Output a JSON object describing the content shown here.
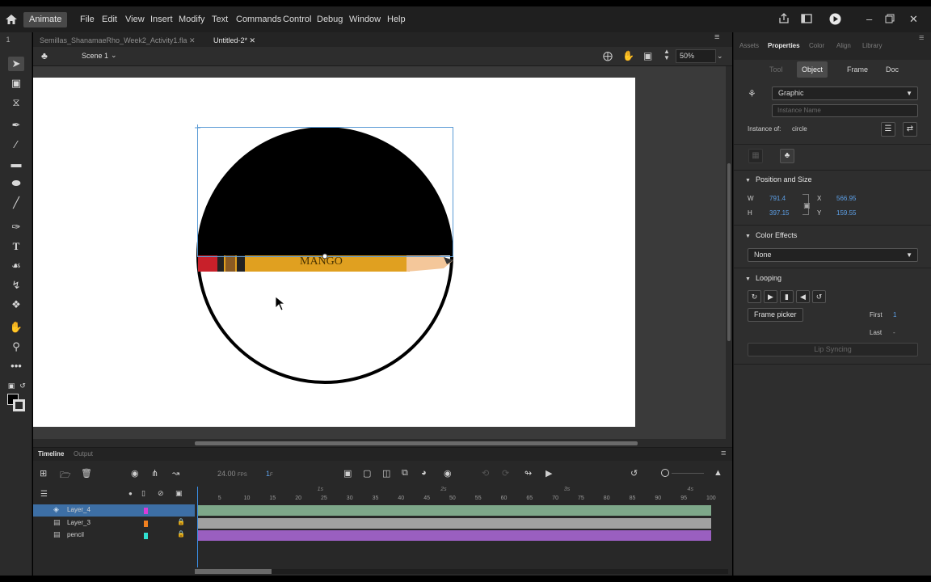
{
  "app": {
    "name": "Animate",
    "menu": [
      "File",
      "Edit",
      "View",
      "Insert",
      "Modify",
      "Text",
      "Commands",
      "Control",
      "Debug",
      "Window",
      "Help"
    ]
  },
  "documents": {
    "tabs": [
      {
        "label": "Semillas_ShanamaeRho_Week2_Activity1.fla"
      },
      {
        "label": "Untitled-2*"
      }
    ]
  },
  "scene": {
    "name": "Scene 1",
    "zoom": "50%"
  },
  "properties": {
    "panel_tabs": [
      "Assets",
      "Properties",
      "Color",
      "Align",
      "Library"
    ],
    "sub_tabs": [
      "Tool",
      "Object",
      "Frame",
      "Doc"
    ],
    "symbol_type": "Graphic",
    "instance_name_placeholder": "Instance Name",
    "instance_of_label": "Instance of:",
    "instance_of_value": "circle",
    "position_size": {
      "title": "Position and Size",
      "w_label": "W",
      "w_value": "791.4",
      "h_label": "H",
      "h_value": "397.15",
      "x_label": "X",
      "x_value": "566.95",
      "y_label": "Y",
      "y_value": "159.55"
    },
    "color_effects": {
      "title": "Color Effects",
      "value": "None"
    },
    "looping": {
      "title": "Looping",
      "frame_picker": "Frame picker",
      "first_label": "First",
      "first_value": "1",
      "last_label": "Last",
      "last_value": "-",
      "lip_syncing": "Lip Syncing"
    }
  },
  "timeline": {
    "tabs": [
      "Timeline",
      "Output"
    ],
    "fps": "24.00",
    "fps_unit": "FPS",
    "frame": "1",
    "frame_unit": "F",
    "ruler_ticks": [
      "5",
      "10",
      "15",
      "20",
      "25",
      "30",
      "35",
      "40",
      "45",
      "50",
      "55",
      "60",
      "65",
      "70",
      "75",
      "80",
      "85",
      "90",
      "95",
      "100"
    ],
    "seconds": [
      "1s",
      "2s",
      "3s",
      "4s"
    ],
    "layers": [
      {
        "name": "Layer_4",
        "color": "#d93bd9",
        "selected": true,
        "locked": false
      },
      {
        "name": "Layer_3",
        "color": "#f08020",
        "selected": false,
        "locked": true
      },
      {
        "name": "pencil",
        "color": "#30e0d0",
        "selected": false,
        "locked": true
      }
    ],
    "frame_colors": [
      "#7ea88a",
      "#a1a1a1",
      "#9a5fc0"
    ]
  },
  "stage": {
    "pencil_text": "MANGO"
  },
  "colors": {
    "accent": "#3a8fe6",
    "selection_box": "#5b9bd5"
  }
}
